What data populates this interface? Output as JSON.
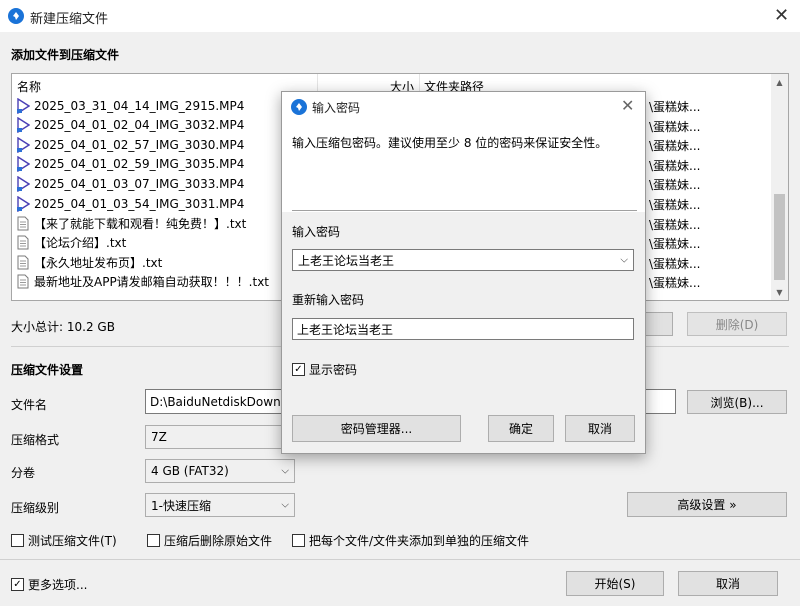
{
  "window": {
    "title": "新建压缩文件",
    "close_glyph": "✕"
  },
  "add_section": {
    "title": "添加文件到压缩文件"
  },
  "filelist": {
    "columns": {
      "name": "名称",
      "size": "大小",
      "path": "文件夹路径"
    },
    "rows": [
      {
        "name": "2025_03_31_04_14_IMG_2915.MP4",
        "path": "\\蛋糕妹...",
        "type": "video"
      },
      {
        "name": "2025_04_01_02_04_IMG_3032.MP4",
        "path": "\\蛋糕妹...",
        "type": "video"
      },
      {
        "name": "2025_04_01_02_57_IMG_3030.MP4",
        "path": "\\蛋糕妹...",
        "type": "video"
      },
      {
        "name": "2025_04_01_02_59_IMG_3035.MP4",
        "path": "\\蛋糕妹...",
        "type": "video"
      },
      {
        "name": "2025_04_01_03_07_IMG_3033.MP4",
        "path": "\\蛋糕妹...",
        "type": "video"
      },
      {
        "name": "2025_04_01_03_54_IMG_3031.MP4",
        "path": "\\蛋糕妹...",
        "type": "video"
      },
      {
        "name": "【来了就能下载和观看！纯免费！】.txt",
        "path": "\\蛋糕妹...",
        "type": "text"
      },
      {
        "name": "【论坛介绍】.txt",
        "path": "\\蛋糕妹...",
        "type": "text"
      },
      {
        "name": "【永久地址发布页】.txt",
        "path": "\\蛋糕妹...",
        "type": "text"
      },
      {
        "name": "最新地址及APP请发邮箱自动获取！！！.txt",
        "path": "\\蛋糕妹...",
        "type": "text"
      }
    ]
  },
  "total_size": "大小总计: 10.2 GB",
  "delete_button": "删除(D)",
  "settings": {
    "title": "压缩文件设置",
    "filename_label": "文件名",
    "filename_value": "D:\\BaiduNetdiskDownlo",
    "browse_button": "浏览(B)...",
    "format_label": "压缩格式",
    "format_value": "7Z",
    "split_label": "分卷",
    "split_value": "4 GB (FAT32)",
    "level_label": "压缩级别",
    "level_value": "1-快速压缩",
    "advanced_button": "高级设置 »",
    "test_checkbox": "测试压缩文件(T)",
    "delete_after_checkbox": "压缩后删除原始文件",
    "separate_checkbox": "把每个文件/文件夹添加到单独的压缩文件",
    "more_options": "更多选项...",
    "start_button": "开始(S)",
    "cancel_button": "取消"
  },
  "password_dialog": {
    "title": "输入密码",
    "close_glyph": "✕",
    "description": "输入压缩包密码。建议使用至少 8 位的密码来保证安全性。",
    "password_label": "输入密码",
    "password_value": "上老王论坛当老王",
    "confirm_label": "重新输入密码",
    "confirm_value": "上老王论坛当老王",
    "show_password": "显示密码",
    "manager_button": "密码管理器...",
    "ok_button": "确定",
    "cancel_button": "取消"
  },
  "colors": {
    "accent": "#1a73d8",
    "video_icon": "#4a3fb5"
  }
}
